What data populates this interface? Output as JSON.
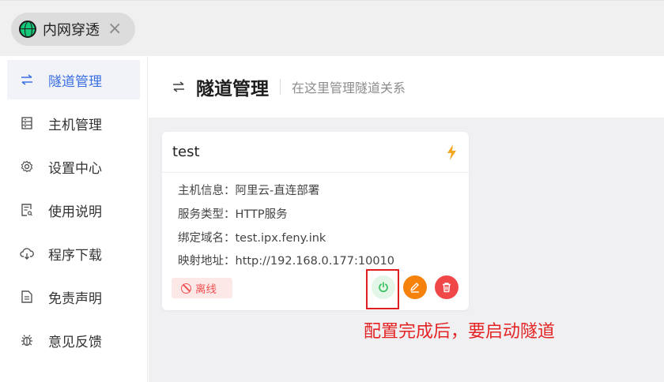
{
  "tabs": [
    {
      "label": "内网穿透",
      "close": "×"
    }
  ],
  "sidebar": {
    "items": [
      {
        "label": "隧道管理",
        "icon": "swap-icon",
        "active": true
      },
      {
        "label": "主机管理",
        "icon": "server-icon"
      },
      {
        "label": "设置中心",
        "icon": "gear-icon"
      },
      {
        "label": "使用说明",
        "icon": "doc-icon"
      },
      {
        "label": "程序下载",
        "icon": "cloud-download-icon"
      },
      {
        "label": "免责声明",
        "icon": "file-icon"
      },
      {
        "label": "意见反馈",
        "icon": "bug-icon"
      }
    ]
  },
  "header": {
    "icon": "swap-icon",
    "title": "隧道管理",
    "subtitle": "在这里管理隧道关系"
  },
  "card": {
    "name": "test",
    "rows": [
      {
        "key": "主机信息：",
        "value": "阿里云-直连部署"
      },
      {
        "key": "服务类型：",
        "value": "HTTP服务"
      },
      {
        "key": "绑定域名：",
        "value": "test.ipx.feny.ink"
      },
      {
        "key": "映射地址：",
        "value": "http://192.168.0.177:10010"
      }
    ],
    "status": "离线"
  },
  "colors": {
    "accent": "#3b6fe0",
    "start": "#2fbf5a",
    "edit": "#f5820d",
    "delete": "#f04848",
    "annotation": "#e42424",
    "bolt": "#f5a623"
  },
  "annotation": "配置完成后，要启动隧道"
}
